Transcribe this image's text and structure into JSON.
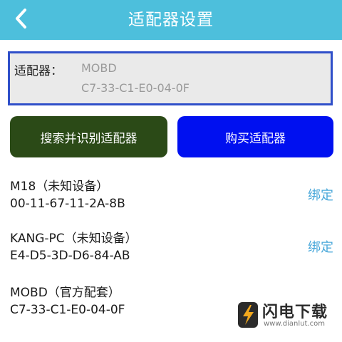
{
  "header": {
    "title": "适配器设置",
    "back_icon": "chevron-left-icon"
  },
  "adapter": {
    "label": "适配器：",
    "name": "MOBD",
    "mac": "C7-33-C1-E0-04-0F"
  },
  "actions": {
    "search_label": "搜索并识别适配器",
    "buy_label": "购买适配器"
  },
  "devices": [
    {
      "name": "M18（未知设备）",
      "mac": "00-11-67-11-2A-8B",
      "action": "绑定"
    },
    {
      "name": "KANG-PC（未知设备）",
      "mac": "E4-D5-3D-D6-84-AB",
      "action": "绑定"
    },
    {
      "name": "MOBD（官方配套）",
      "mac": "C7-33-C1-E0-04-0F"
    }
  ],
  "watermark": {
    "text": "闪电下载",
    "url": "www.dianlut.com"
  },
  "colors": {
    "header": "#4dbfdc",
    "search_button": "#2b4a17",
    "buy_button": "#0010f0",
    "link": "#4aa8da",
    "adapter_border": "#2f4fc9"
  }
}
